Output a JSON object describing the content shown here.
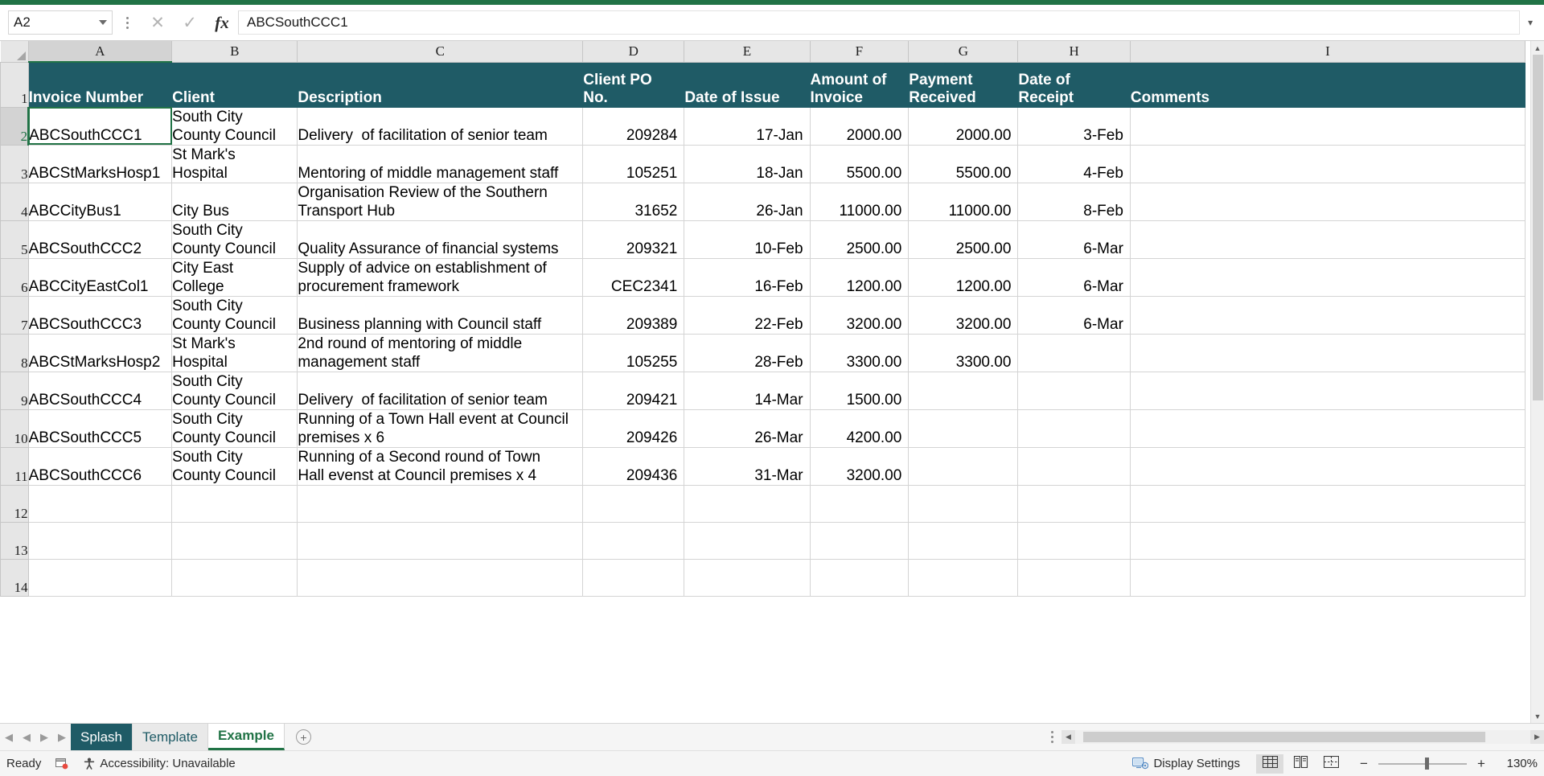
{
  "formula_bar": {
    "name_box_value": "A2",
    "cancel_icon": "close-icon",
    "confirm_icon": "check-icon",
    "function_icon": "fx",
    "formula_value": "ABCSouthCCC1"
  },
  "grid": {
    "column_letters": [
      "A",
      "B",
      "C",
      "D",
      "E",
      "F",
      "G",
      "H",
      "I"
    ],
    "row_numbers": [
      "1",
      "2",
      "3",
      "4",
      "5",
      "6",
      "7",
      "8",
      "9",
      "10",
      "11",
      "12",
      "13",
      "14"
    ],
    "selected_cell": "A2",
    "headers": [
      "Invoice Number",
      "Client",
      "Description",
      "Client PO\nNo.",
      "Date of Issue",
      "Amount of\nInvoice",
      "Payment\nReceived",
      "Date of\nReceipt",
      "Comments"
    ],
    "rows": [
      {
        "row": "2",
        "invoice_number": "ABCSouthCCC1",
        "client": "South City\nCounty Council",
        "description": "Delivery  of facilitation of senior team",
        "client_po_no": "209284",
        "date_of_issue": "17-Jan",
        "amount_of_invoice": "2000.00",
        "payment_received": "2000.00",
        "date_of_receipt": "3-Feb",
        "comments": ""
      },
      {
        "row": "3",
        "invoice_number": "ABCStMarksHosp1",
        "client": "St Mark's\nHospital",
        "description": "Mentoring of middle management staff",
        "client_po_no": "105251",
        "date_of_issue": "18-Jan",
        "amount_of_invoice": "5500.00",
        "payment_received": "5500.00",
        "date_of_receipt": "4-Feb",
        "comments": ""
      },
      {
        "row": "4",
        "invoice_number": "ABCCityBus1",
        "client": "City Bus",
        "description": "Organisation Review of the Southern\nTransport Hub",
        "client_po_no": "31652",
        "date_of_issue": "26-Jan",
        "amount_of_invoice": "11000.00",
        "payment_received": "11000.00",
        "date_of_receipt": "8-Feb",
        "comments": ""
      },
      {
        "row": "5",
        "invoice_number": "ABCSouthCCC2",
        "client": "South City\nCounty Council",
        "description": "Quality Assurance of financial systems",
        "client_po_no": "209321",
        "date_of_issue": "10-Feb",
        "amount_of_invoice": "2500.00",
        "payment_received": "2500.00",
        "date_of_receipt": "6-Mar",
        "comments": ""
      },
      {
        "row": "6",
        "invoice_number": "ABCCityEastCol1",
        "client": "City East\nCollege",
        "description": "Supply of advice on establishment of\nprocurement framework",
        "client_po_no": "CEC2341",
        "date_of_issue": "16-Feb",
        "amount_of_invoice": "1200.00",
        "payment_received": "1200.00",
        "date_of_receipt": "6-Mar",
        "comments": ""
      },
      {
        "row": "7",
        "invoice_number": "ABCSouthCCC3",
        "client": "South City\nCounty Council",
        "description": "Business planning with Council staff",
        "client_po_no": "209389",
        "date_of_issue": "22-Feb",
        "amount_of_invoice": "3200.00",
        "payment_received": "3200.00",
        "date_of_receipt": "6-Mar",
        "comments": ""
      },
      {
        "row": "8",
        "invoice_number": "ABCStMarksHosp2",
        "client": "St Mark's\nHospital",
        "description": "2nd round of mentoring of middle\nmanagement staff",
        "client_po_no": "105255",
        "date_of_issue": "28-Feb",
        "amount_of_invoice": "3300.00",
        "payment_received": "3300.00",
        "date_of_receipt": "",
        "comments": ""
      },
      {
        "row": "9",
        "invoice_number": "ABCSouthCCC4",
        "client": "South City\nCounty Council",
        "description": "Delivery  of facilitation of senior team",
        "client_po_no": "209421",
        "date_of_issue": "14-Mar",
        "amount_of_invoice": "1500.00",
        "payment_received": "",
        "date_of_receipt": "",
        "comments": ""
      },
      {
        "row": "10",
        "invoice_number": "ABCSouthCCC5",
        "client": "South City\nCounty Council",
        "description": "Running of a Town Hall event at Council\npremises x 6",
        "client_po_no": "209426",
        "date_of_issue": "26-Mar",
        "amount_of_invoice": "4200.00",
        "payment_received": "",
        "date_of_receipt": "",
        "comments": ""
      },
      {
        "row": "11",
        "invoice_number": "ABCSouthCCC6",
        "client": "South City\nCounty Council",
        "description": "Running of a Second round of Town\nHall evenst at Council premises x 4",
        "client_po_no": "209436",
        "date_of_issue": "31-Mar",
        "amount_of_invoice": "3200.00",
        "payment_received": "",
        "date_of_receipt": "",
        "comments": ""
      },
      {
        "row": "12",
        "invoice_number": "",
        "client": "",
        "description": "",
        "client_po_no": "",
        "date_of_issue": "",
        "amount_of_invoice": "",
        "payment_received": "",
        "date_of_receipt": "",
        "comments": ""
      },
      {
        "row": "13",
        "invoice_number": "",
        "client": "",
        "description": "",
        "client_po_no": "",
        "date_of_issue": "",
        "amount_of_invoice": "",
        "payment_received": "",
        "date_of_receipt": "",
        "comments": ""
      },
      {
        "row": "14",
        "invoice_number": "",
        "client": "",
        "description": "",
        "client_po_no": "",
        "date_of_issue": "",
        "amount_of_invoice": "",
        "payment_received": "",
        "date_of_receipt": "",
        "comments": ""
      }
    ]
  },
  "sheet_tabs": {
    "first_label": "◀",
    "prev_label": "◀",
    "next_label": "▶",
    "last_label": "▶",
    "tabs": [
      {
        "label": "Splash",
        "active": false
      },
      {
        "label": "Template",
        "active": false
      },
      {
        "label": "Example",
        "active": true
      }
    ],
    "add_sheet_label": "+"
  },
  "status_bar": {
    "ready_text": "Ready",
    "macro_icon": "record-macro-icon",
    "accessibility_text": "Accessibility: Unavailable",
    "display_settings_text": "Display Settings",
    "view_normal_icon": "normal-view-icon",
    "view_layout_icon": "page-layout-icon",
    "view_pagebreak_icon": "page-break-preview-icon",
    "zoom_out_label": "−",
    "zoom_in_label": "+",
    "zoom_percent": "130%"
  },
  "colors": {
    "header_band": "#1f5b66",
    "excel_green": "#217346",
    "grid_line": "#d4d4d4"
  }
}
